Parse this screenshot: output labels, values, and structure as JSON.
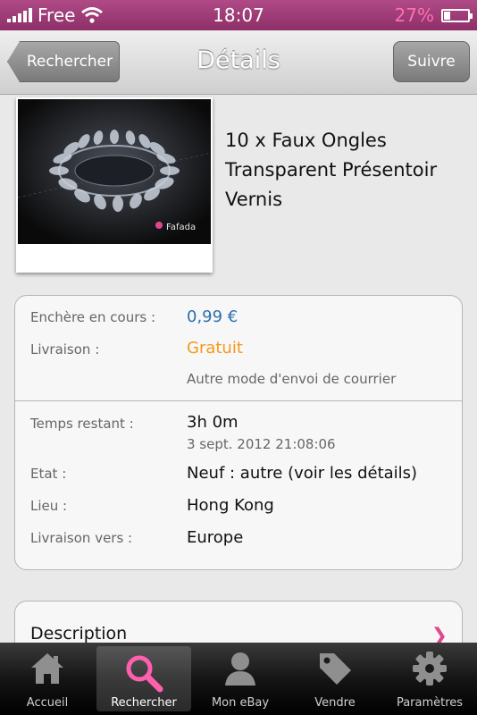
{
  "status_bar": {
    "carrier": "Free",
    "time": "18:07",
    "battery_percent": "27%",
    "battery_level": 0.27
  },
  "nav": {
    "title": "Détails",
    "back_label": "Rechercher",
    "follow_label": "Suivre"
  },
  "product": {
    "title": "10 x Faux Ongles Transparent Présentoir Vernis",
    "image_watermark": "Fafada"
  },
  "details": {
    "bid_label": "Enchère en cours :",
    "bid_value": "0,99 €",
    "shipping_label": "Livraison :",
    "shipping_value": "Gratuit",
    "shipping_note": "Autre mode d'envoi de courrier",
    "time_left_label": "Temps restant :",
    "time_left_value": "3h 0m",
    "end_date": "3 sept. 2012 21:08:06",
    "condition_label": "Etat :",
    "condition_value": "Neuf : autre (voir les détails)",
    "location_label": "Lieu :",
    "location_value": "Hong Kong",
    "ships_to_label": "Livraison vers :",
    "ships_to_value": "Europe"
  },
  "description": {
    "title": "Description"
  },
  "tabs": [
    {
      "label": "Accueil",
      "icon": "home-icon"
    },
    {
      "label": "Rechercher",
      "icon": "search-icon"
    },
    {
      "label": "Mon eBay",
      "icon": "user-icon"
    },
    {
      "label": "Vendre",
      "icon": "tag-icon"
    },
    {
      "label": "Paramètres",
      "icon": "gear-icon"
    }
  ],
  "active_tab": 1,
  "colors": {
    "status_bar": "#9a3a74",
    "accent_pink": "#e0478f",
    "price_blue": "#2a6fb0",
    "free_orange": "#f39a1b"
  }
}
